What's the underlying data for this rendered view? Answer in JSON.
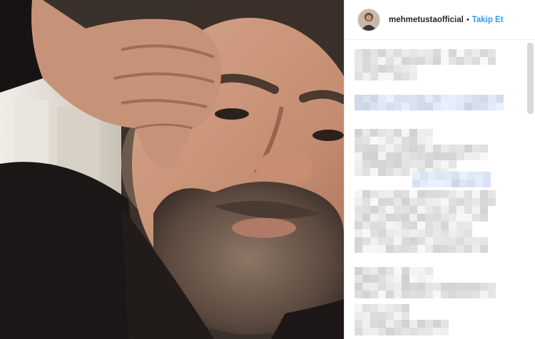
{
  "post": {
    "username": "mehmetustaofficial",
    "separator": "•",
    "follow_label": "Takip Et"
  },
  "colors": {
    "follow_link": "#3897f0",
    "username_text": "#262626",
    "blur_light": "#e6e6e6",
    "blur_blue": "#dfe7f4"
  },
  "icons": {
    "avatar": "profile-photo-icon"
  }
}
